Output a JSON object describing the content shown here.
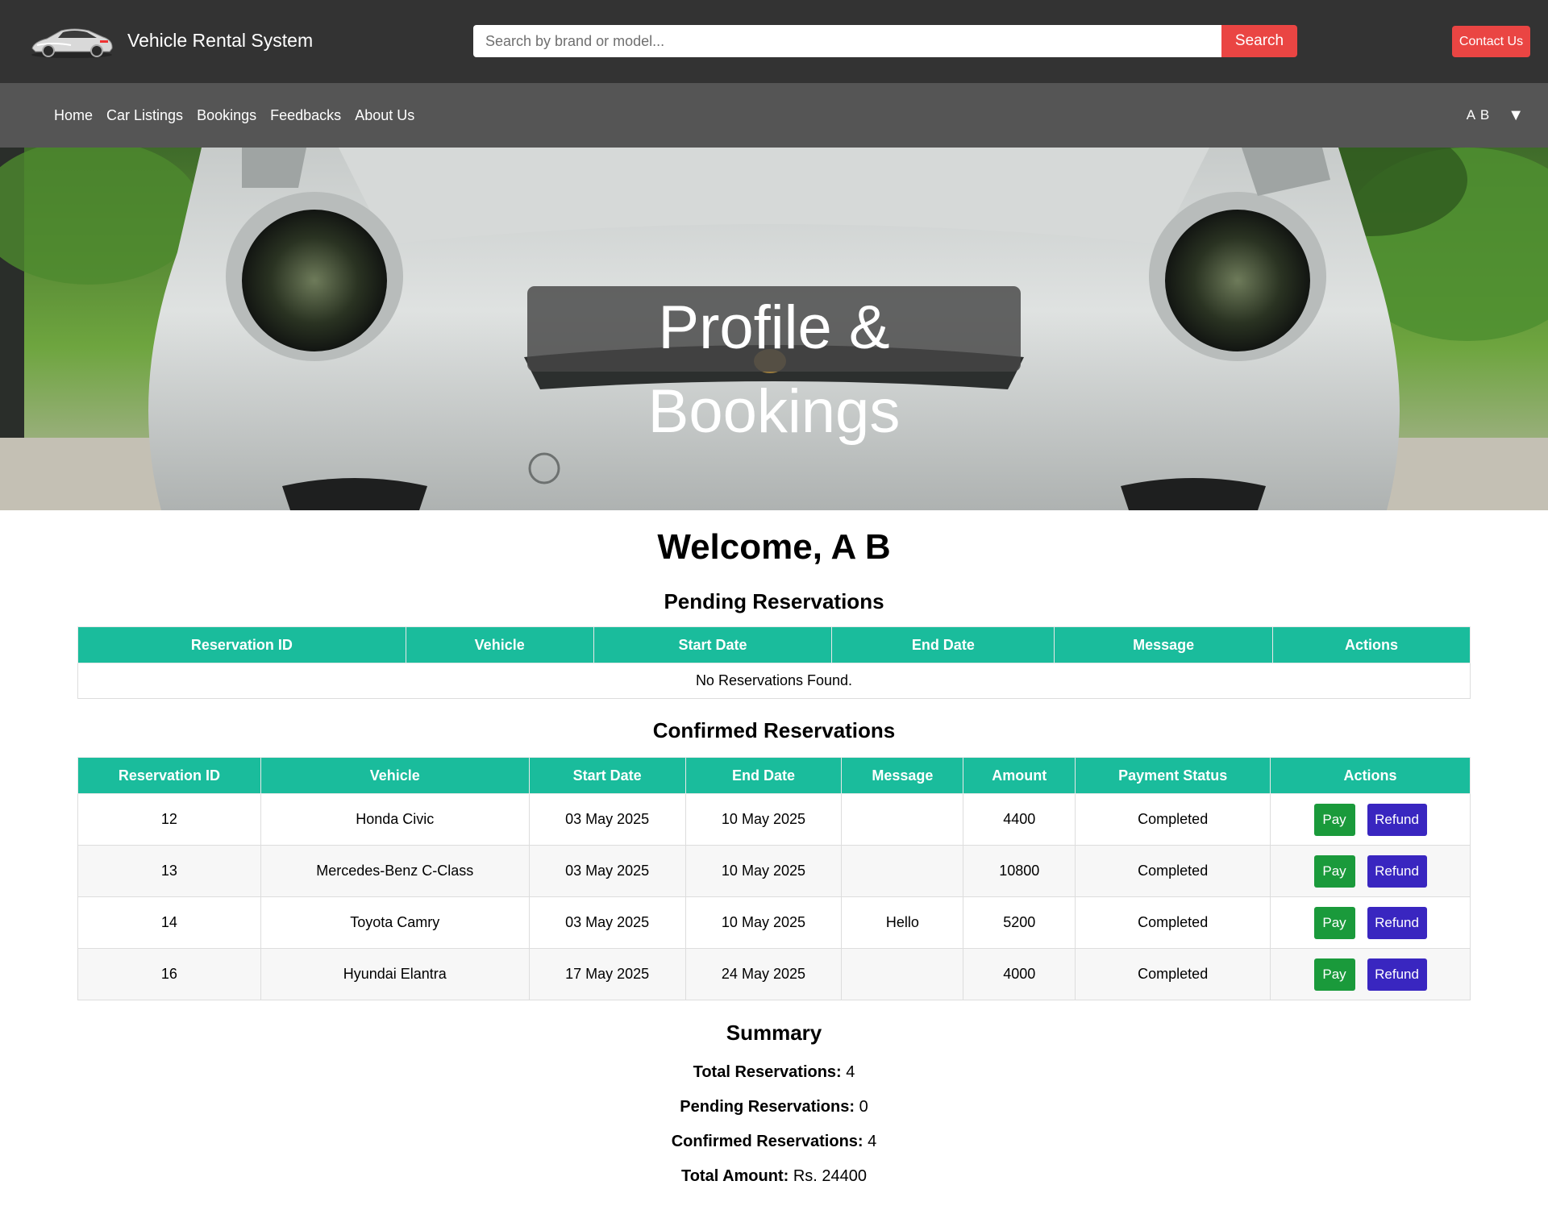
{
  "header": {
    "brand": "Vehicle Rental System",
    "search": {
      "placeholder": "Search by brand or model...",
      "button_label": "Search"
    },
    "contact_label": "Contact Us"
  },
  "nav": {
    "links": [
      "Home",
      "Car Listings",
      "Bookings",
      "Feedbacks",
      "About Us"
    ],
    "user": "A B"
  },
  "hero": {
    "title": "Profile & Bookings"
  },
  "welcome": "Welcome, A B",
  "pending": {
    "title": "Pending Reservations",
    "columns": [
      "Reservation ID",
      "Vehicle",
      "Start Date",
      "End Date",
      "Message",
      "Actions"
    ],
    "empty_text": "No Reservations Found."
  },
  "confirmed": {
    "title": "Confirmed Reservations",
    "columns": [
      "Reservation ID",
      "Vehicle",
      "Start Date",
      "End Date",
      "Message",
      "Amount",
      "Payment Status",
      "Actions"
    ],
    "pay_label": "Pay",
    "refund_label": "Refund",
    "rows": [
      {
        "id": "12",
        "vehicle": "Honda Civic",
        "start": "03 May 2025",
        "end": "10 May 2025",
        "message": "",
        "amount": "4400",
        "status": "Completed"
      },
      {
        "id": "13",
        "vehicle": "Mercedes-Benz C-Class",
        "start": "03 May 2025",
        "end": "10 May 2025",
        "message": "",
        "amount": "10800",
        "status": "Completed"
      },
      {
        "id": "14",
        "vehicle": "Toyota Camry",
        "start": "03 May 2025",
        "end": "10 May 2025",
        "message": "Hello",
        "amount": "5200",
        "status": "Completed"
      },
      {
        "id": "16",
        "vehicle": "Hyundai Elantra",
        "start": "17 May 2025",
        "end": "24 May 2025",
        "message": "",
        "amount": "4000",
        "status": "Completed"
      }
    ]
  },
  "summary": {
    "title": "Summary",
    "total_label": "Total Reservations:",
    "total_value": "4",
    "pending_label": "Pending Reservations:",
    "pending_value": "0",
    "confirmed_label": "Confirmed Reservations:",
    "confirmed_value": "4",
    "amount_label": "Total Amount:",
    "amount_value": "Rs. 24400"
  },
  "colors": {
    "header_bg": "#333333",
    "nav_bg": "#555555",
    "accent_red": "#ea4543",
    "table_header": "#1abc9c",
    "pay": "#1a9a3b",
    "refund": "#3926c0"
  }
}
